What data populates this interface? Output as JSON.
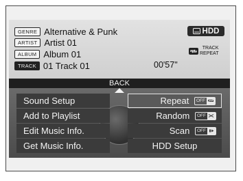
{
  "info": {
    "genre": {
      "tag": "GENRE",
      "value": "Alternative & Punk"
    },
    "artist": {
      "tag": "ARTIST",
      "value": "Artist 01"
    },
    "album": {
      "tag": "ALBUM",
      "value": "Album 01"
    },
    "track": {
      "tag": "TRACK",
      "value": "01 Track 01"
    },
    "time": "00'57\"",
    "source_label": "HDD",
    "track_repeat": {
      "line1": "TRACK",
      "line2": "REPEAT",
      "icon": "repeat-icon"
    }
  },
  "back_label": "BACK",
  "menu": {
    "left": [
      "Sound Setup",
      "Add to Playlist",
      "Edit Music Info.",
      "Get Music Info."
    ],
    "right": {
      "repeat": {
        "label": "Repeat",
        "badge": "OFF",
        "icon": "repeat-icon"
      },
      "random": {
        "label": "Random",
        "badge": "OFF",
        "icon": "shuffle-icon"
      },
      "scan": {
        "label": "Scan",
        "badge": "OFF",
        "icon": "scan-icon"
      },
      "hdd_setup": {
        "label": "HDD Setup"
      }
    },
    "selected": "repeat"
  },
  "colors": {
    "bar": "#1f1f1f",
    "menu_item": "#3b3b3b",
    "text_light": "#f4f4f4"
  }
}
